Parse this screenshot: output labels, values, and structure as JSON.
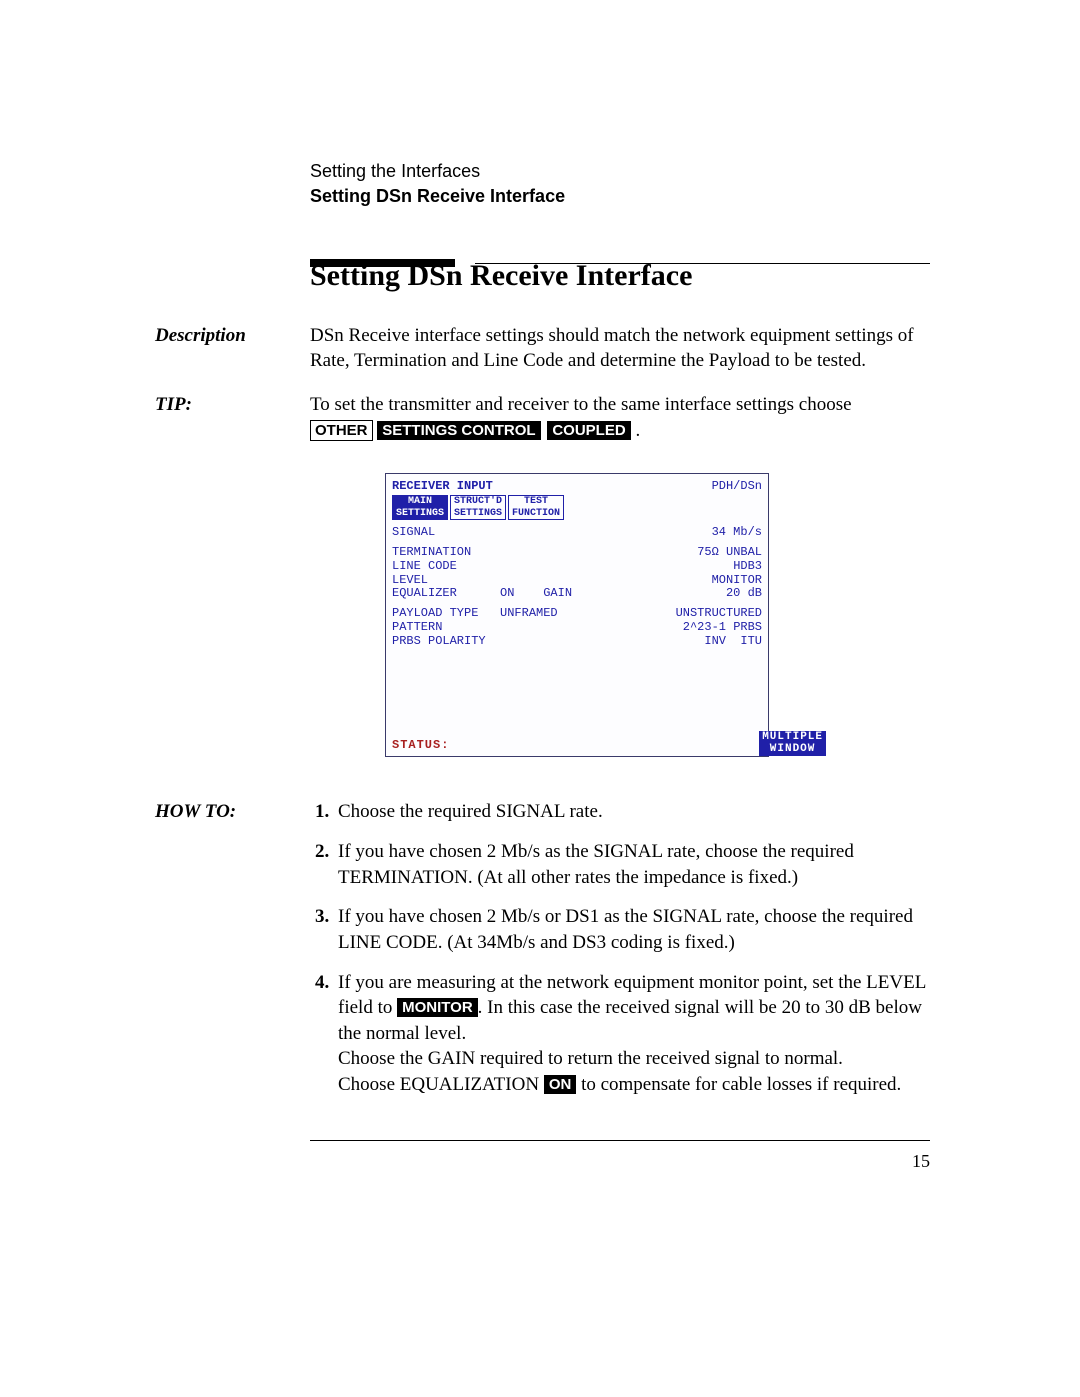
{
  "header": {
    "chapter": "Setting the Interfaces",
    "section": "Setting DSn Receive Interface"
  },
  "title": "Setting DSn Receive Interface",
  "description": {
    "label": "Description",
    "text": "DSn Receive interface settings should match the network equipment settings of Rate, Termination and Line Code and determine the Payload to be tested."
  },
  "tip": {
    "label": "TIP:",
    "lead": "To set the transmitter and receiver to the same interface settings choose ",
    "other": "OTHER",
    "settings_control": "SETTINGS CONTROL",
    "coupled": "COUPLED",
    "period": " ."
  },
  "screen": {
    "title": "RECEIVER INPUT",
    "mode": "PDH/DSn",
    "tabs": {
      "main": "MAIN\nSETTINGS",
      "struct": "STRUCT'D\nSETTINGS",
      "test": "TEST\nFUNCTION"
    },
    "rows": [
      {
        "k": "SIGNAL",
        "v": "34 Mb/s"
      },
      {
        "k": "TERMINATION",
        "v": "75Ω UNBAL"
      },
      {
        "k": "LINE CODE",
        "v": "HDB3"
      },
      {
        "k": "LEVEL",
        "v": "MONITOR"
      },
      {
        "k": "EQUALIZER      ON    GAIN",
        "v": "20 dB"
      },
      {
        "k": "PAYLOAD TYPE   UNFRAMED",
        "v": "UNSTRUCTURED"
      },
      {
        "k": "PATTERN",
        "v": "2^23-1 PRBS"
      },
      {
        "k": "PRBS POLARITY",
        "v": "INV  ITU"
      }
    ],
    "status": "STATUS:",
    "multiple_window": "MULTIPLE\nWINDOW"
  },
  "howto": {
    "label": "HOW TO:",
    "steps": {
      "s1": "Choose the required SIGNAL rate.",
      "s2": "If you have chosen 2 Mb/s as the SIGNAL rate, choose the required TERMINATION. (At all other rates the impedance is fixed.)",
      "s3": "If you have chosen 2 Mb/s or DS1 as the SIGNAL rate, choose the required LINE CODE. (At 34Mb/s and DS3 coding is fixed.)",
      "s4a": "If you are measuring at the network equipment monitor point, set the LEVEL field to ",
      "s4_monitor": "MONITOR",
      "s4b": ". In this case the received signal will be 20 to 30 dB below the normal level.",
      "s4c": "Choose the GAIN required to return the received signal to normal.",
      "s4d_pre": "Choose EQUALIZATION ",
      "s4_on": "ON",
      "s4d_post": " to compensate for cable losses if required."
    }
  },
  "page_number": "15"
}
